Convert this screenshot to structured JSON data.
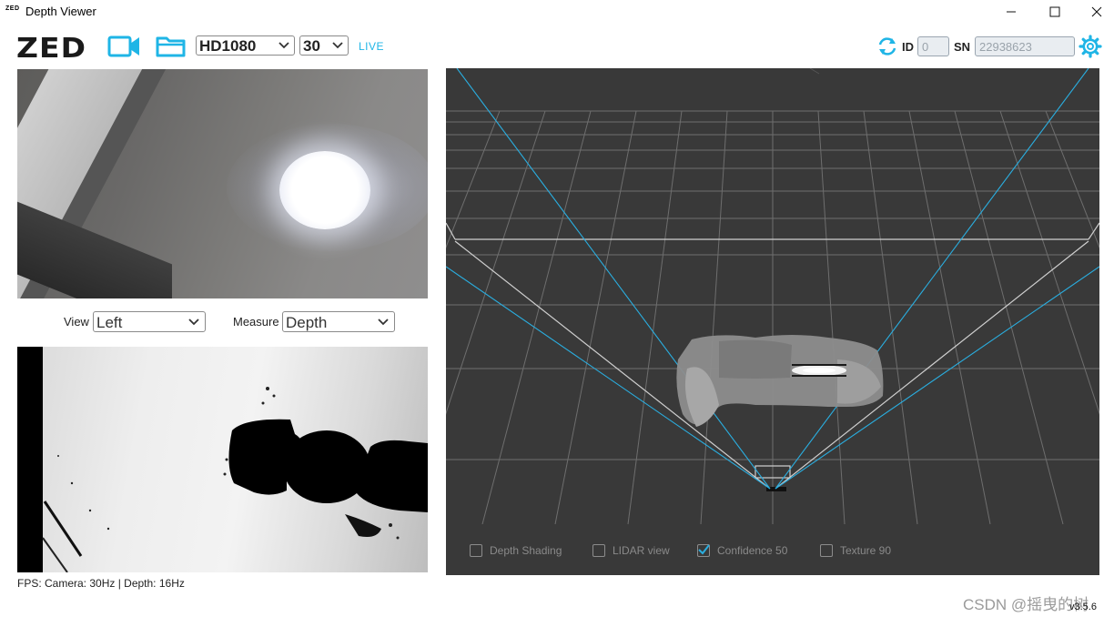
{
  "window": {
    "logo_small": "ZED",
    "title": "Depth Viewer"
  },
  "toolbar": {
    "logo": "ZED",
    "resolution": "HD1080",
    "fps": "30",
    "live_label": "LIVE",
    "id_label": "ID",
    "id_value": "0",
    "sn_label": "SN",
    "sn_value": "22938623",
    "accent_color": "#1fb5e6"
  },
  "controls": {
    "view_label": "View",
    "view_value": "Left",
    "measure_label": "Measure",
    "measure_value": "Depth"
  },
  "status": {
    "fps_text": "FPS: Camera: 30Hz | Depth: 16Hz"
  },
  "viewer3d": {
    "options": [
      {
        "label": "Depth Shading",
        "checked": false
      },
      {
        "label": "LIDAR view",
        "checked": false
      },
      {
        "label": "Confidence 50",
        "checked": true
      },
      {
        "label": "Texture 90",
        "checked": false
      }
    ]
  },
  "footer": {
    "watermark": "CSDN @摇曳的树",
    "version": "v3.5.6"
  },
  "icons": [
    "refresh-icon",
    "gear-icon",
    "video-camera-icon",
    "folder-icon",
    "chevron-down-icon",
    "minimize-icon",
    "maximize-icon",
    "close-icon",
    "check-icon"
  ]
}
